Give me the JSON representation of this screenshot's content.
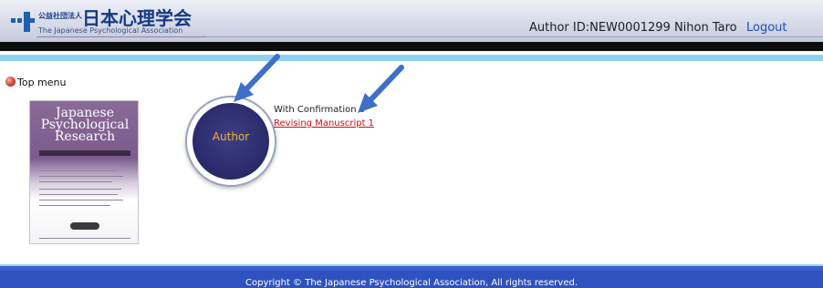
{
  "header": {
    "org_prefix": "公益社団法人",
    "org_name_jp": "日本心理学会",
    "org_name_en": "The Japanese Psychological Association",
    "user_info": "Author  ID:NEW0001299 Nihon Taro",
    "logout_label": "Logout"
  },
  "menu": {
    "title": "Top menu"
  },
  "cover": {
    "title_lines": [
      "Japanese",
      "Psychological",
      "Research"
    ]
  },
  "author_button": {
    "label": "Author"
  },
  "status": {
    "with_confirmation": "With Confirmation 0",
    "revising_manuscript": "Revising Manuscript 1"
  },
  "footer": {
    "copyright": "Copyright © The Japanese Psychological Association, All rights reserved."
  },
  "colors": {
    "header_bg": "#d7dbe9",
    "accent_blue": "#2f52c0",
    "light_blue": "#8ed2ef",
    "author_circle": "#2b2d6e",
    "author_text": "#f2b225",
    "link_red": "#d10f0f",
    "arrow": "#3f6fc6"
  }
}
